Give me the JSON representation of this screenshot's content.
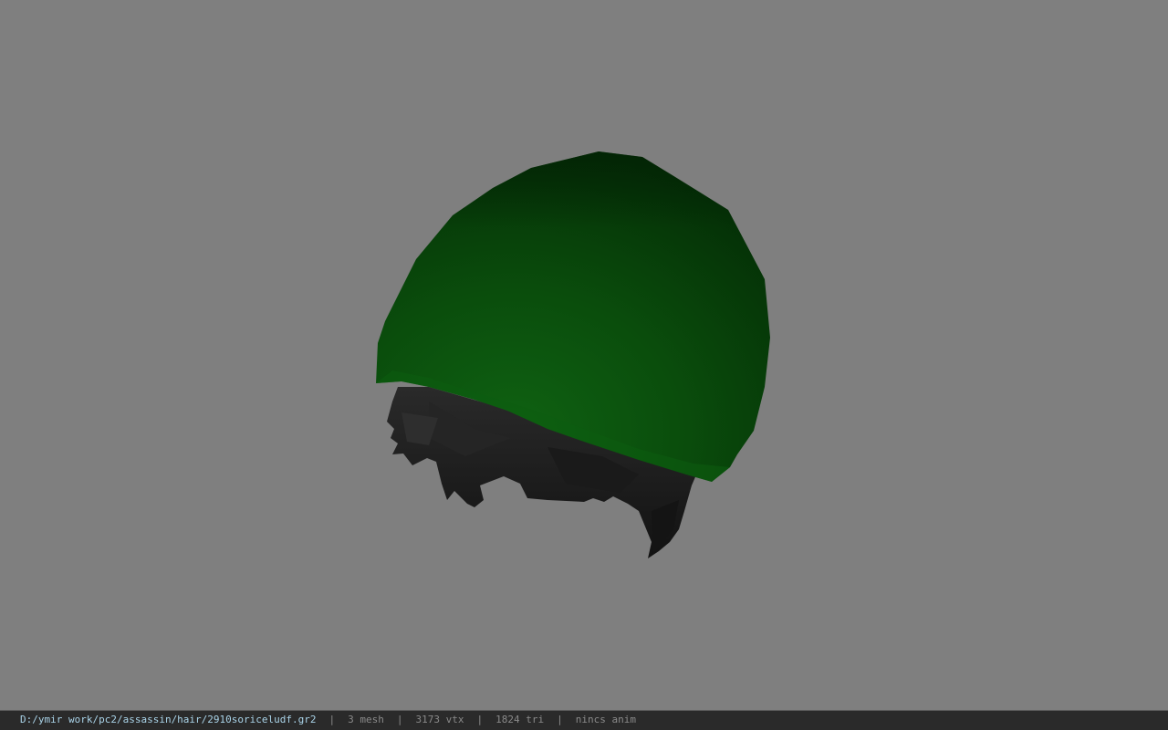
{
  "viewport": {
    "background_color": "#7f7f7f",
    "model": {
      "cap_color": "#0f5a0f",
      "hair_color": "#1c1c1c"
    }
  },
  "statusbar": {
    "file_path": "D:/ymir work/pc2/assassin/hair/2910soriceludf.gr2",
    "separator": "|",
    "mesh_count": "3 mesh",
    "vertex_count": "3173 vtx",
    "triangle_count": "1824 tri",
    "anim_status": "nincs anim",
    "path_color": "#a9d3e8"
  }
}
